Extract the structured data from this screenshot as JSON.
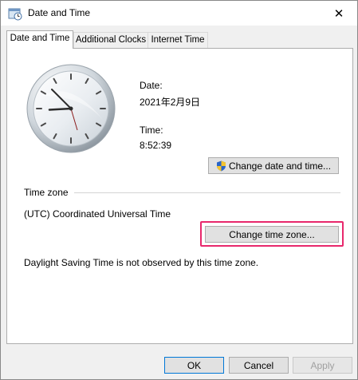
{
  "window": {
    "title": "Date and Time",
    "close_glyph": "✕"
  },
  "tabs": [
    {
      "label": "Date and Time",
      "active": true
    },
    {
      "label": "Additional Clocks",
      "active": false
    },
    {
      "label": "Internet Time",
      "active": false
    }
  ],
  "date_section": {
    "date_label": "Date:",
    "date_value": "2021年2月9日",
    "time_label": "Time:",
    "time_value": "8:52:39",
    "change_datetime_button": "Change date and time..."
  },
  "timezone_section": {
    "heading": "Time zone",
    "current_zone": "(UTC) Coordinated Universal Time",
    "change_zone_button": "Change time zone...",
    "dst_note": "Daylight Saving Time is not observed by this time zone."
  },
  "footer": {
    "ok": "OK",
    "cancel": "Cancel",
    "apply": "Apply"
  },
  "colors": {
    "highlight": "#e8286c",
    "accent": "#0078d7"
  },
  "icons": {
    "title": "clock-app-icon",
    "uac": "shield-icon",
    "close": "close-icon"
  }
}
